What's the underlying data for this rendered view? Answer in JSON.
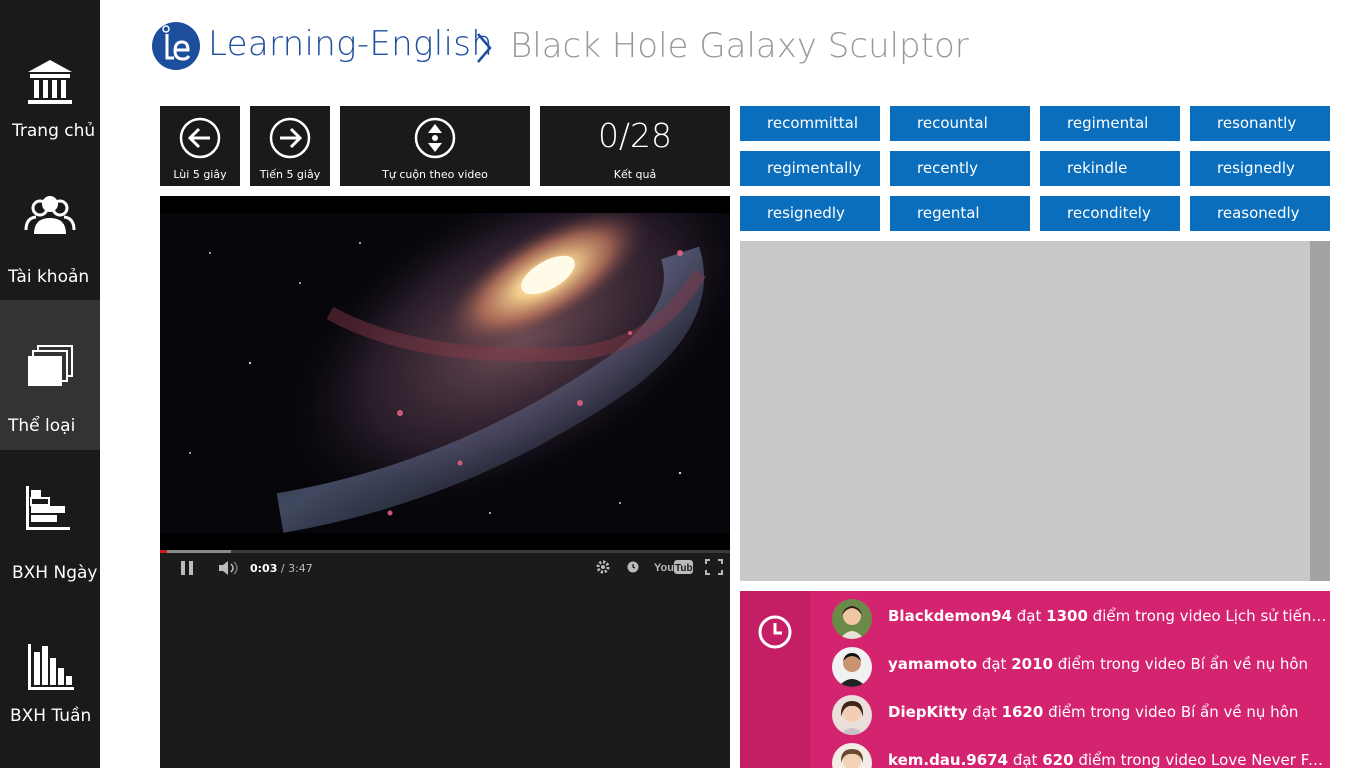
{
  "sidebar": {
    "items": [
      {
        "label": "Trang chủ",
        "icon": "home-icon"
      },
      {
        "label": "Tài khoản",
        "icon": "users-icon"
      },
      {
        "label": "Thể loại",
        "icon": "categories-icon"
      },
      {
        "label": "BXH Ngày",
        "icon": "daily-ranking-icon"
      },
      {
        "label": "BXH Tuần",
        "icon": "weekly-ranking-icon"
      }
    ],
    "active": "Thể loại"
  },
  "header": {
    "app_title": "Learning-English",
    "page_title": "Black Hole Galaxy Sculptor"
  },
  "controls": {
    "back_label": "Lùi 5 giây",
    "forward_label": "Tiến 5 giây",
    "autoscroll_label": "Tự cuộn theo video",
    "score_value": "0/28",
    "score_label": "Kết quả"
  },
  "video": {
    "current_time": "0:03",
    "duration": "/ 3:47",
    "played_fraction": 0.013,
    "buffered_fraction": 0.125,
    "brand": "YouTube"
  },
  "words": [
    "recommittal",
    "recountal",
    "regimental",
    "resonantly",
    "regimentally",
    "recently",
    "rekindle",
    "resignedly",
    "resignedly",
    "regental",
    "reconditely",
    "reasonedly"
  ],
  "feed": [
    {
      "user": "Blackdemon94",
      "verb": "đạt",
      "score": "1300",
      "rest": "điểm trong video Lịch sử tiến hóa ..."
    },
    {
      "user": "yamamoto",
      "verb": "đạt",
      "score": "2010",
      "rest": "điểm trong video Bí ẩn về nụ hôn"
    },
    {
      "user": "DiepKitty",
      "verb": "đạt",
      "score": "1620",
      "rest": "điểm trong video Bí ẩn về nụ hôn"
    },
    {
      "user": "kem.dau.9674",
      "verb": "đạt",
      "score": "620",
      "rest": "điểm trong video Love Never Fails"
    }
  ],
  "colors": {
    "sidebar_bg": "#1a1a1a",
    "accent_blue": "#0a6ebd",
    "brand_blue": "#1d4e9e",
    "feed_pink": "#d4246f"
  }
}
